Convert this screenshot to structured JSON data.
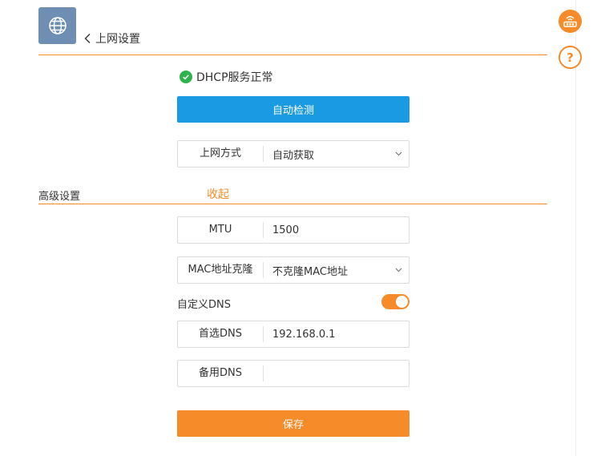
{
  "header": {
    "icon": "globe-icon",
    "back_icon": "chevron-left-icon",
    "title": "上网设置"
  },
  "side_toolbar": {
    "router_icon": "router-icon",
    "help_icon": "help-icon",
    "help_glyph": "?"
  },
  "status": {
    "icon": "check-circle-icon",
    "text": "DHCP服务正常"
  },
  "buttons": {
    "auto_detect": "自动检测",
    "save": "保存"
  },
  "connection": {
    "label": "上网方式",
    "value": "自动获取"
  },
  "advanced": {
    "title": "高级设置",
    "collapse": "收起",
    "mtu": {
      "label": "MTU",
      "value": "1500"
    },
    "mac_clone": {
      "label": "MAC地址克隆",
      "value": "不克隆MAC地址"
    },
    "custom_dns": {
      "label": "自定义DNS",
      "enabled": true
    },
    "primary_dns": {
      "label": "首选DNS",
      "value": "192.168.0.1"
    },
    "secondary_dns": {
      "label": "备用DNS",
      "value": ""
    }
  },
  "colors": {
    "accent": "#f68b2a",
    "primary_button": "#1b9ae4",
    "success": "#2db34a",
    "header_icon_bg": "#6e8fb3"
  }
}
